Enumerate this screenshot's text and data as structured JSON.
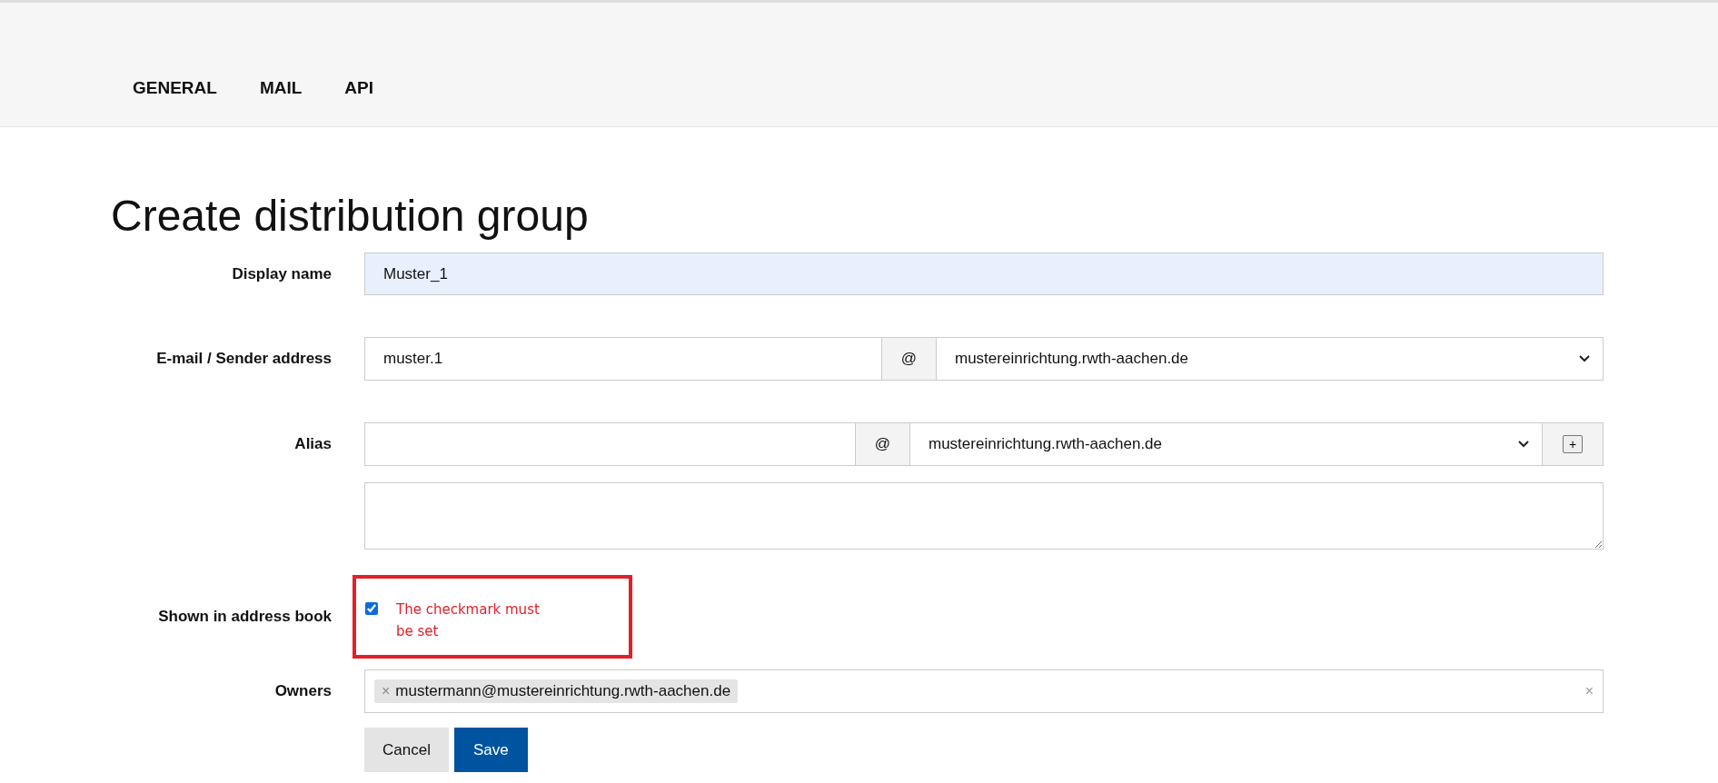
{
  "tabs": [
    {
      "label": "GENERAL",
      "selected": false
    },
    {
      "label": "MAIL",
      "selected": false
    },
    {
      "label": "API",
      "selected": false
    }
  ],
  "title": "Create distribution group",
  "display_name": {
    "label": "Display name",
    "value": "Muster_1"
  },
  "email": {
    "label": "E-mail / Sender address",
    "value": "muster.1",
    "at": "@",
    "domain": "mustereinrichtung.rwth-aachen.de"
  },
  "alias": {
    "label": "Alias",
    "at": "@",
    "domain": "mustereinrichtung.rwth-aachen.de",
    "add": "+"
  },
  "shown_in_address_book": {
    "label": "Shown in address book",
    "checked": true,
    "annotation": "The checkmark must be set"
  },
  "owners": {
    "label": "Owners",
    "tags": [
      {
        "remove": "×",
        "text": "mustermann@mustereinrichtung.rwth-aachen.de"
      }
    ],
    "clear": "×"
  },
  "buttons": [
    {
      "label": "Cancel",
      "kind": "secondary"
    },
    {
      "label": "Save",
      "kind": "primary"
    }
  ]
}
